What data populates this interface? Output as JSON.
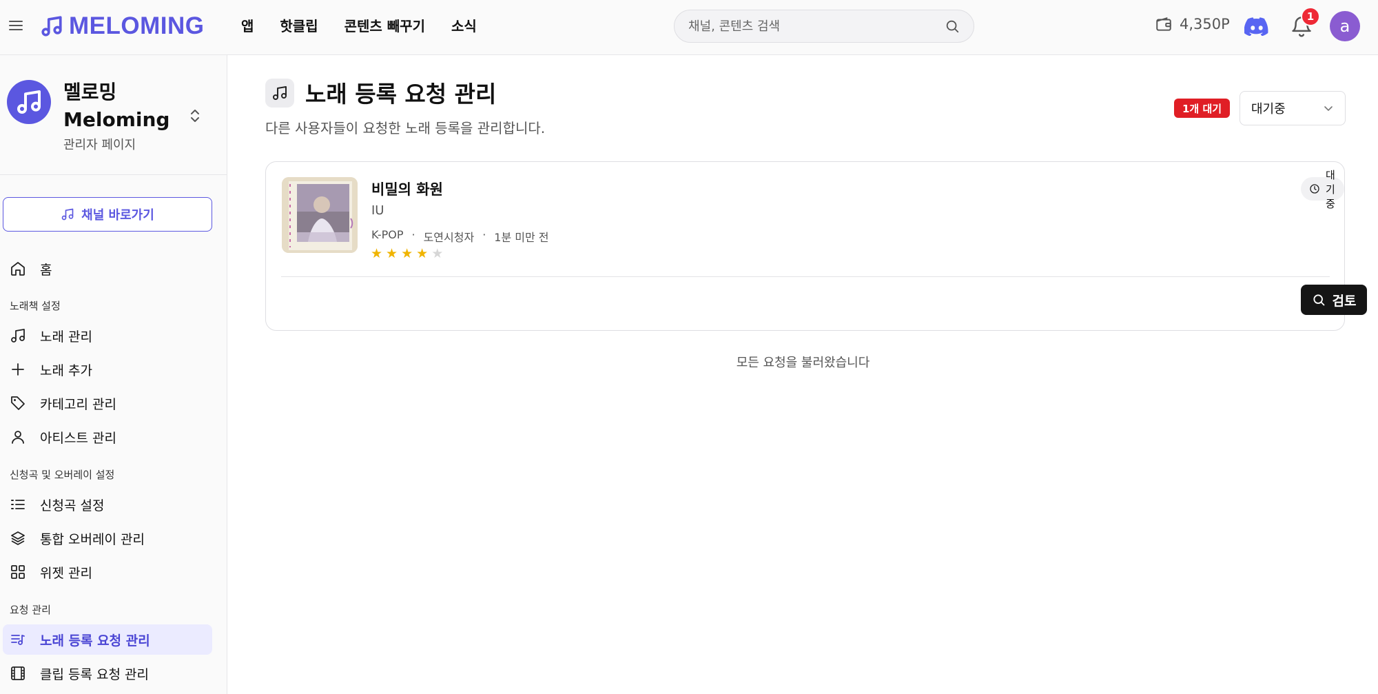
{
  "header": {
    "logo_text": "MELOMING",
    "nav": [
      "앱",
      "핫클립",
      "콘텐츠 빼꾸기",
      "소식"
    ],
    "search_placeholder": "채널, 콘텐츠 검색",
    "points": "4,350P",
    "notification_count": "1",
    "avatar_letter": "a",
    "accent_color": "#5b57e0"
  },
  "sidebar": {
    "brand_name_line1": "멜로밍",
    "brand_name_line2": "Meloming",
    "brand_sub": "관리자 페이지",
    "channel_button": "채널 바로가기",
    "home": "홈",
    "section_songbook": "노래책 설정",
    "song_manage": "노래 관리",
    "song_add": "노래 추가",
    "category_manage": "카테고리 관리",
    "artist_manage": "아티스트 관리",
    "section_request": "신청곡 및 오버레이 설정",
    "request_settings": "신청곡 설정",
    "overlay_manage": "통합 오버레이 관리",
    "widget_manage": "위젯 관리",
    "section_requests": "요청 관리",
    "song_request_manage": "노래 등록 요청 관리",
    "clip_request_manage": "클립 등록 요청 관리"
  },
  "main": {
    "title": "노래 등록 요청 관리",
    "description": "다른 사용자들이 요청한 노래 등록을 관리합니다.",
    "pending_badge": "1개 대기",
    "status_filter": "대기중",
    "request": {
      "title": "비밀의 화원",
      "artist": "IU",
      "genre": "K-POP",
      "requester": "도연시청자",
      "time": "1분 미만 전",
      "rating": 4,
      "rating_max": 5,
      "status": "대기중",
      "review_button": "검토"
    },
    "footer_text": "모든 요청을 불러왔습니다"
  }
}
